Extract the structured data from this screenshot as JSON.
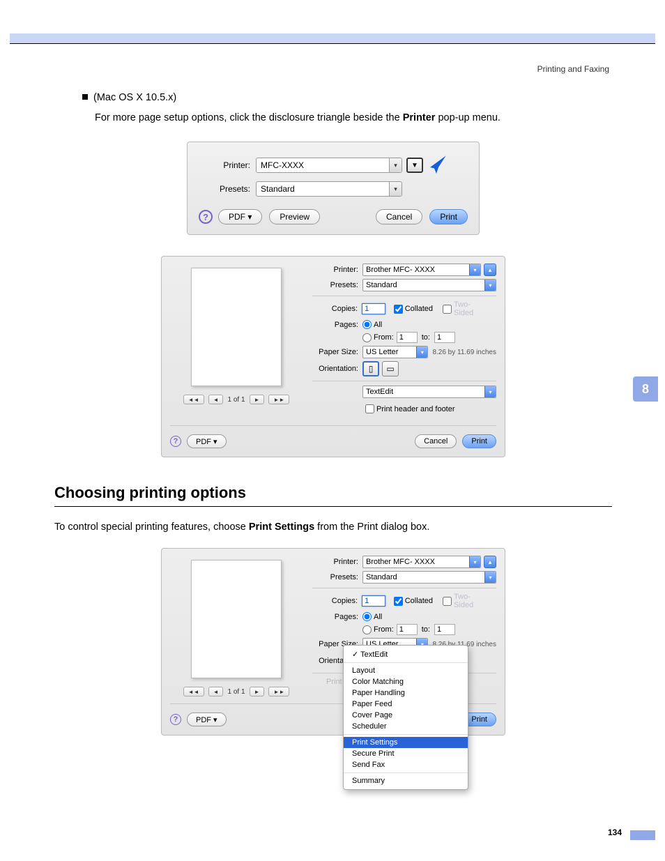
{
  "header": {
    "section": "Printing and Faxing"
  },
  "chapter": {
    "number": "8"
  },
  "page_number": "134",
  "bullet": {
    "text": "(Mac OS X 10.5.x)"
  },
  "intro_line": {
    "prefix": "For more page setup options, click the disclosure triangle beside the ",
    "bold": "Printer",
    "suffix": " pop-up menu."
  },
  "dialog1": {
    "printer_label": "Printer:",
    "printer_value": "MFC-XXXX",
    "presets_label": "Presets:",
    "presets_value": "Standard",
    "pdf_label": "PDF ▾",
    "preview_label": "Preview",
    "cancel_label": "Cancel",
    "print_label": "Print"
  },
  "dialog2": {
    "printer_label": "Printer:",
    "printer_value": "Brother MFC- XXXX",
    "presets_label": "Presets:",
    "presets_value": "Standard",
    "copies_label": "Copies:",
    "copies_value": "1",
    "collated_label": "Collated",
    "two_sided_label": "Two-Sided",
    "pages_label": "Pages:",
    "all_label": "All",
    "from_label": "From:",
    "from_value": "1",
    "to_label": "to:",
    "to_value": "1",
    "paper_size_label": "Paper Size:",
    "paper_size_value": "US Letter",
    "paper_dims": "8.26 by 11.69 inches",
    "orientation_label": "Orientation:",
    "panel_popup": "TextEdit",
    "header_footer_label": "Print header and footer",
    "pager_text": "1 of 1",
    "pdf_label": "PDF ▾",
    "cancel_label": "Cancel",
    "print_label": "Print"
  },
  "section2": {
    "heading": "Choosing printing options",
    "body_prefix": "To control special printing features, choose ",
    "body_bold": "Print Settings",
    "body_suffix": " from the Print dialog box."
  },
  "dialog3": {
    "printer_label": "Printer:",
    "printer_value": "Brother MFC- XXXX",
    "presets_label": "Presets:",
    "presets_value": "Standard",
    "copies_label": "Copies:",
    "copies_value": "1",
    "collated_label": "Collated",
    "two_sided_label": "Two-Sided",
    "pages_label": "Pages:",
    "all_label": "All",
    "from_label": "From:",
    "from_value": "1",
    "to_label": "to:",
    "to_value": "1",
    "paper_size_label": "Paper Size:",
    "paper_size_value": "US Letter",
    "paper_dims": "8.26 by 11.69 inches",
    "orientation_label": "Orientation:",
    "ghost_text": "Print header and footer",
    "pager_text": "1 of 1",
    "pdf_label": "PDF ▾",
    "print_label": "Print",
    "menu": {
      "current": "TextEdit",
      "items": [
        "Layout",
        "Color Matching",
        "Paper Handling",
        "Paper Feed",
        "Cover Page",
        "Scheduler"
      ],
      "highlight": "Print Settings",
      "after1": "Secure Print",
      "after2": "Send Fax",
      "last": "Summary"
    }
  }
}
